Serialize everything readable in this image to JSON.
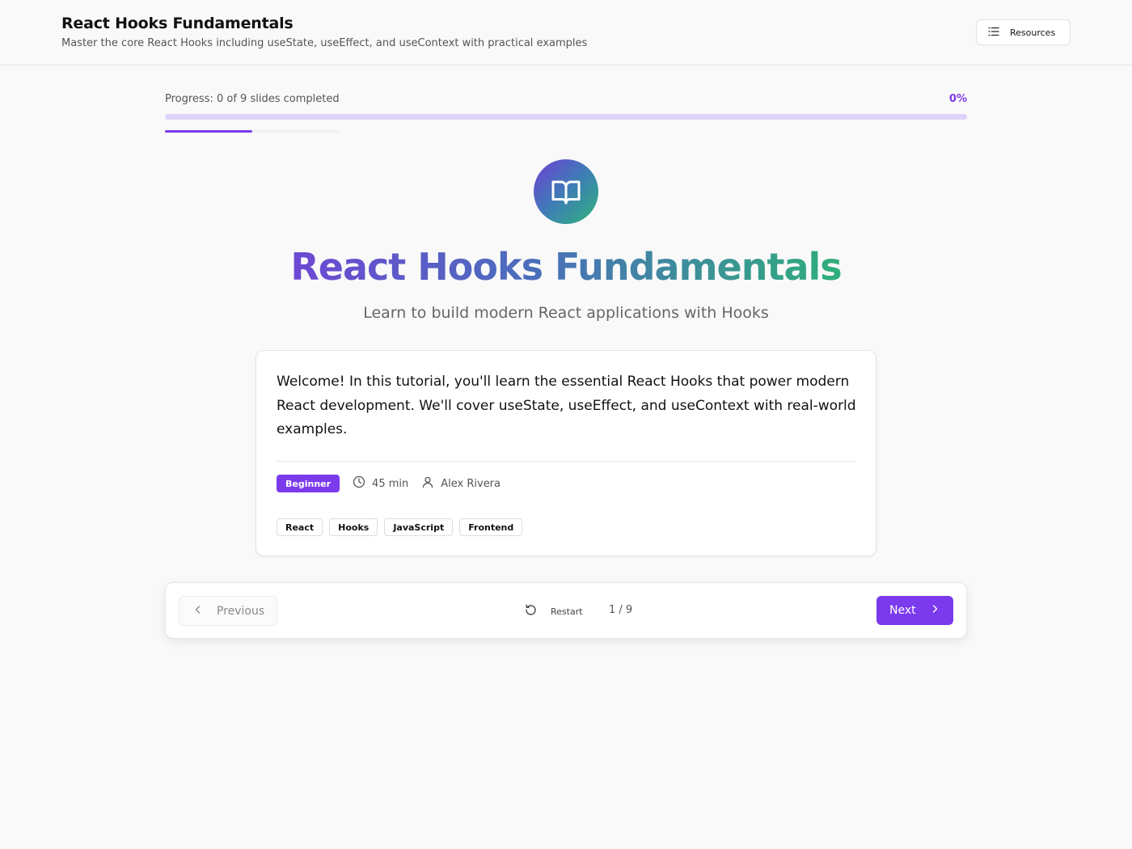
{
  "header": {
    "title": "React Hooks Fundamentals",
    "subtitle": "Master the core React Hooks including useState, useEffect, and useContext with practical examples",
    "resources_label": "Resources",
    "resources_icon": "list-icon"
  },
  "progress": {
    "label": "Progress: 0 of 9 slides completed",
    "percent_label": "0%",
    "percent": 0,
    "current_slide": 1,
    "total_slides": 9
  },
  "hero": {
    "icon": "book-open-icon",
    "title": "React Hooks Fundamentals",
    "subtitle": "Learn to build modern React applications with Hooks"
  },
  "card": {
    "body": "Welcome! In this tutorial, you'll learn the essential React Hooks that power modern React development. We'll cover useState, useEffect, and useContext with real-world examples.",
    "level": "Beginner",
    "duration": "45 min",
    "author": "Alex Rivera",
    "tags": [
      "React",
      "Hooks",
      "JavaScript",
      "Frontend"
    ]
  },
  "nav": {
    "previous_label": "Previous",
    "restart_label": "Restart",
    "counter": "1 / 9",
    "next_label": "Next"
  },
  "colors": {
    "accent": "#7c3aed",
    "track": "#ddd3fb",
    "gradient_start": "#6d48d3",
    "gradient_end": "#2fae7a"
  }
}
